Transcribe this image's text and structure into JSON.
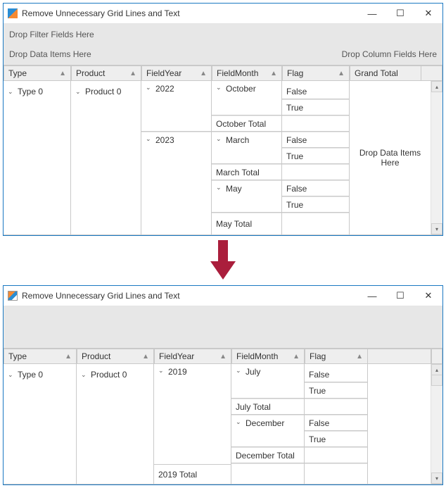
{
  "win1": {
    "title": "Remove Unnecessary Grid Lines and Text",
    "drop_filter": "Drop Filter Fields Here",
    "drop_data": "Drop Data Items Here",
    "drop_cols": "Drop Column Fields Here",
    "drop_data_area": "Drop Data Items Here",
    "headers": {
      "type": "Type",
      "product": "Product",
      "year": "FieldYear",
      "month": "FieldMonth",
      "flag": "Flag",
      "grand_total": "Grand Total"
    },
    "rows": {
      "type0": "Type 0",
      "product0": "Product 0",
      "year1": "2022",
      "year2": "2023",
      "m_oct": "October",
      "m_oct_total": "October Total",
      "m_mar": "March",
      "m_mar_total": "March Total",
      "m_may": "May",
      "m_may_total": "May Total",
      "f_false": "False",
      "f_true": "True"
    }
  },
  "win2": {
    "title": "Remove Unnecessary Grid Lines and Text",
    "headers": {
      "type": "Type",
      "product": "Product",
      "year": "FieldYear",
      "month": "FieldMonth",
      "flag": "Flag"
    },
    "rows": {
      "type0": "Type 0",
      "product0": "Product 0",
      "year": "2019",
      "year_total": "2019 Total",
      "m_jul": "July",
      "m_jul_total": "July Total",
      "m_dec": "December",
      "m_dec_total": "December Total",
      "f_false": "False",
      "f_true": "True"
    }
  }
}
